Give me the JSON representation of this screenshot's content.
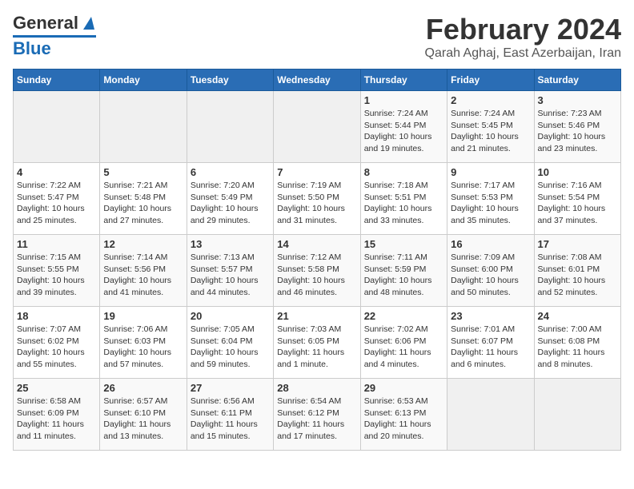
{
  "logo": {
    "line1": "General",
    "line2": "Blue"
  },
  "title": "February 2024",
  "subtitle": "Qarah Aghaj, East Azerbaijan, Iran",
  "days_of_week": [
    "Sunday",
    "Monday",
    "Tuesday",
    "Wednesday",
    "Thursday",
    "Friday",
    "Saturday"
  ],
  "weeks": [
    [
      {
        "day": "",
        "detail": ""
      },
      {
        "day": "",
        "detail": ""
      },
      {
        "day": "",
        "detail": ""
      },
      {
        "day": "",
        "detail": ""
      },
      {
        "day": "1",
        "detail": "Sunrise: 7:24 AM\nSunset: 5:44 PM\nDaylight: 10 hours and 19 minutes."
      },
      {
        "day": "2",
        "detail": "Sunrise: 7:24 AM\nSunset: 5:45 PM\nDaylight: 10 hours and 21 minutes."
      },
      {
        "day": "3",
        "detail": "Sunrise: 7:23 AM\nSunset: 5:46 PM\nDaylight: 10 hours and 23 minutes."
      }
    ],
    [
      {
        "day": "4",
        "detail": "Sunrise: 7:22 AM\nSunset: 5:47 PM\nDaylight: 10 hours and 25 minutes."
      },
      {
        "day": "5",
        "detail": "Sunrise: 7:21 AM\nSunset: 5:48 PM\nDaylight: 10 hours and 27 minutes."
      },
      {
        "day": "6",
        "detail": "Sunrise: 7:20 AM\nSunset: 5:49 PM\nDaylight: 10 hours and 29 minutes."
      },
      {
        "day": "7",
        "detail": "Sunrise: 7:19 AM\nSunset: 5:50 PM\nDaylight: 10 hours and 31 minutes."
      },
      {
        "day": "8",
        "detail": "Sunrise: 7:18 AM\nSunset: 5:51 PM\nDaylight: 10 hours and 33 minutes."
      },
      {
        "day": "9",
        "detail": "Sunrise: 7:17 AM\nSunset: 5:53 PM\nDaylight: 10 hours and 35 minutes."
      },
      {
        "day": "10",
        "detail": "Sunrise: 7:16 AM\nSunset: 5:54 PM\nDaylight: 10 hours and 37 minutes."
      }
    ],
    [
      {
        "day": "11",
        "detail": "Sunrise: 7:15 AM\nSunset: 5:55 PM\nDaylight: 10 hours and 39 minutes."
      },
      {
        "day": "12",
        "detail": "Sunrise: 7:14 AM\nSunset: 5:56 PM\nDaylight: 10 hours and 41 minutes."
      },
      {
        "day": "13",
        "detail": "Sunrise: 7:13 AM\nSunset: 5:57 PM\nDaylight: 10 hours and 44 minutes."
      },
      {
        "day": "14",
        "detail": "Sunrise: 7:12 AM\nSunset: 5:58 PM\nDaylight: 10 hours and 46 minutes."
      },
      {
        "day": "15",
        "detail": "Sunrise: 7:11 AM\nSunset: 5:59 PM\nDaylight: 10 hours and 48 minutes."
      },
      {
        "day": "16",
        "detail": "Sunrise: 7:09 AM\nSunset: 6:00 PM\nDaylight: 10 hours and 50 minutes."
      },
      {
        "day": "17",
        "detail": "Sunrise: 7:08 AM\nSunset: 6:01 PM\nDaylight: 10 hours and 52 minutes."
      }
    ],
    [
      {
        "day": "18",
        "detail": "Sunrise: 7:07 AM\nSunset: 6:02 PM\nDaylight: 10 hours and 55 minutes."
      },
      {
        "day": "19",
        "detail": "Sunrise: 7:06 AM\nSunset: 6:03 PM\nDaylight: 10 hours and 57 minutes."
      },
      {
        "day": "20",
        "detail": "Sunrise: 7:05 AM\nSunset: 6:04 PM\nDaylight: 10 hours and 59 minutes."
      },
      {
        "day": "21",
        "detail": "Sunrise: 7:03 AM\nSunset: 6:05 PM\nDaylight: 11 hours and 1 minute."
      },
      {
        "day": "22",
        "detail": "Sunrise: 7:02 AM\nSunset: 6:06 PM\nDaylight: 11 hours and 4 minutes."
      },
      {
        "day": "23",
        "detail": "Sunrise: 7:01 AM\nSunset: 6:07 PM\nDaylight: 11 hours and 6 minutes."
      },
      {
        "day": "24",
        "detail": "Sunrise: 7:00 AM\nSunset: 6:08 PM\nDaylight: 11 hours and 8 minutes."
      }
    ],
    [
      {
        "day": "25",
        "detail": "Sunrise: 6:58 AM\nSunset: 6:09 PM\nDaylight: 11 hours and 11 minutes."
      },
      {
        "day": "26",
        "detail": "Sunrise: 6:57 AM\nSunset: 6:10 PM\nDaylight: 11 hours and 13 minutes."
      },
      {
        "day": "27",
        "detail": "Sunrise: 6:56 AM\nSunset: 6:11 PM\nDaylight: 11 hours and 15 minutes."
      },
      {
        "day": "28",
        "detail": "Sunrise: 6:54 AM\nSunset: 6:12 PM\nDaylight: 11 hours and 17 minutes."
      },
      {
        "day": "29",
        "detail": "Sunrise: 6:53 AM\nSunset: 6:13 PM\nDaylight: 11 hours and 20 minutes."
      },
      {
        "day": "",
        "detail": ""
      },
      {
        "day": "",
        "detail": ""
      }
    ]
  ]
}
